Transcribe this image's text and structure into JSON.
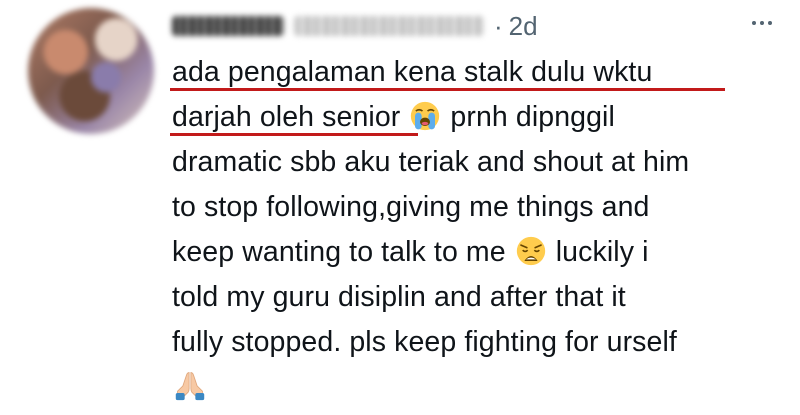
{
  "tweet": {
    "separator": "·",
    "time": "2d",
    "lines": [
      {
        "before": "ada pengalaman kena stalk dulu wktu",
        "emoji": "",
        "after": ""
      },
      {
        "before": "darjah oleh senior ",
        "emoji": "loudly-crying-face",
        "after": " prnh dipnggil"
      },
      {
        "before": "dramatic sbb aku teriak and shout at him",
        "emoji": "",
        "after": ""
      },
      {
        "before": "to stop following,giving me things and",
        "emoji": "",
        "after": ""
      },
      {
        "before": "keep wanting to talk to me ",
        "emoji": "weary-face",
        "after": " luckily i"
      },
      {
        "before": "told my guru disiplin and after that it",
        "emoji": "",
        "after": ""
      },
      {
        "before": "fully stopped. pls keep fighting for urself",
        "emoji": "",
        "after": ""
      },
      {
        "before": "",
        "emoji": "folded-hands",
        "after": ""
      }
    ]
  },
  "colors": {
    "text": "#0f1419",
    "muted": "#536471",
    "underline": "#c21a1a"
  },
  "icons": {
    "more": "more-horizontal-icon"
  }
}
